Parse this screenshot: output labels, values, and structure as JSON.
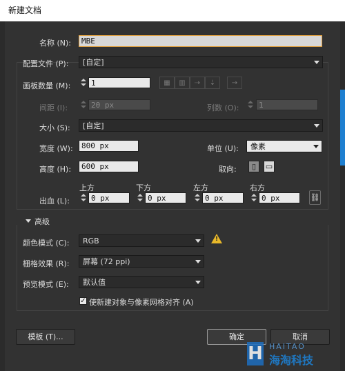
{
  "window": {
    "title": "新建文档"
  },
  "form": {
    "name": {
      "label": "名称 (N):",
      "value": "MBE"
    },
    "profile": {
      "label": "配置文件 (P):",
      "value": "[自定]"
    },
    "artboard_count": {
      "label": "画板数量 (M):",
      "value": "1"
    },
    "spacing": {
      "label": "间距 (I):",
      "value": "20 px"
    },
    "columns": {
      "label": "列数 (O):",
      "value": "1"
    },
    "size": {
      "label": "大小 (S):",
      "value": "[自定]"
    },
    "width": {
      "label": "宽度 (W):",
      "value": "800 px"
    },
    "units": {
      "label": "单位 (U):",
      "value": "像素"
    },
    "height": {
      "label": "高度 (H):",
      "value": "600 px"
    },
    "orientation": {
      "label": "取向:"
    },
    "bleed": {
      "label": "出血 (L):",
      "top_label": "上方",
      "top_value": "0 px",
      "bottom_label": "下方",
      "bottom_value": "0 px",
      "left_label": "左方",
      "left_value": "0 px",
      "right_label": "右方",
      "right_value": "0 px"
    }
  },
  "advanced": {
    "header": "高级",
    "color_mode": {
      "label": "颜色模式 (C):",
      "value": "RGB"
    },
    "raster_effects": {
      "label": "栅格效果 (R):",
      "value": "屏幕 (72 ppi)"
    },
    "preview_mode": {
      "label": "预览模式 (E):",
      "value": "默认值"
    },
    "align_pixel_grid": {
      "label": "使新建对象与像素网格对齐 (A)",
      "checked": true
    }
  },
  "buttons": {
    "templates": "模板 (T)...",
    "ok": "确定",
    "cancel": "取消"
  },
  "watermark": {
    "latin": "HAITAO",
    "cn": "海淘科技",
    "letter": "H"
  },
  "icons": [
    "chevron-down-icon",
    "warning-icon",
    "link-icon",
    "portrait-icon",
    "landscape-icon",
    "grid-by-row-icon",
    "grid-by-column-icon",
    "arrange-by-row-icon",
    "arrange-by-column-icon",
    "arrow-right-icon"
  ],
  "colors": {
    "dialog_bg": "#323232",
    "warning": "#e8b82a",
    "accent_blue": "#1e7fd0"
  }
}
